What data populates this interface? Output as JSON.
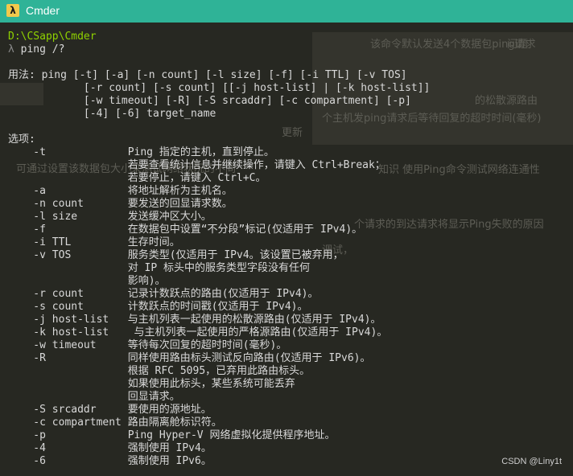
{
  "window": {
    "icon_glyph": "λ",
    "title": "Cmder"
  },
  "terminal": {
    "path": "D:\\CSapp\\Cmder",
    "prompt_symbol": "λ",
    "command": "ping /?",
    "lines": [
      "用法: ping [-t] [-a] [-n count] [-l size] [-f] [-i TTL] [-v TOS]",
      "            [-r count] [-s count] [[-j host-list] | [-k host-list]]",
      "            [-w timeout] [-R] [-S srcaddr] [-c compartment] [-p]",
      "            [-4] [-6] target_name",
      "",
      "选项:",
      "    -t             Ping 指定的主机，直到停止。",
      "                   若要查看统计信息并继续操作，请键入 Ctrl+Break；",
      "                   若要停止，请键入 Ctrl+C。",
      "    -a             将地址解析为主机名。",
      "    -n count       要发送的回显请求数。",
      "    -l size        发送缓冲区大小。",
      "    -f             在数据包中设置“不分段”标记(仅适用于 IPv4)。",
      "    -i TTL         生存时间。",
      "    -v TOS         服务类型(仅适用于 IPv4。该设置已被弃用，",
      "                   对 IP 标头中的服务类型字段没有任何",
      "                   影响)。",
      "    -r count       记录计数跃点的路由(仅适用于 IPv4)。",
      "    -s count       计数跃点的时间戳(仅适用于 IPv4)。",
      "    -j host-list   与主机列表一起使用的松散源路由(仅适用于 IPv4)。",
      "    -k host-list    与主机列表一起使用的严格源路由(仅适用于 IPv4)。",
      "    -w timeout     等待每次回复的超时时间(毫秒)。",
      "    -R             同样使用路由标头测试反向路由(仅适用于 IPv6)。",
      "                   根据 RFC 5095，已弃用此路由标头。",
      "                   如果使用此标头，某些系统可能丢弃",
      "                   回显请求。",
      "    -S srcaddr     要使用的源地址。",
      "    -c compartment 路由隔离舱标识符。",
      "    -p             Ping Hyper-V 网络虚拟化提供程序地址。",
      "    -4             强制使用 IPv4。",
      "    -6             强制使用 IPv6。"
    ]
  },
  "background_text": [
    "该命令默认发送4个数据包ping请求",
    "问题",
    "个主机发ping请求后等待回复的超时时间(毫秒)",
    "的松散源路由",
    "更新",
    "知识  使用Ping命令测试网络连通性",
    "个请求的到达请求将显示Ping失败的原因",
    "调试，",
    "可通过设置该数据包大小来测试网络状况的不同"
  ],
  "watermark": "CSDN @Liny1t",
  "colors": {
    "title_bar": "#2fb397",
    "terminal_bg": "#272822",
    "path_green": "#8fd200",
    "text": "#d9d9d9"
  }
}
